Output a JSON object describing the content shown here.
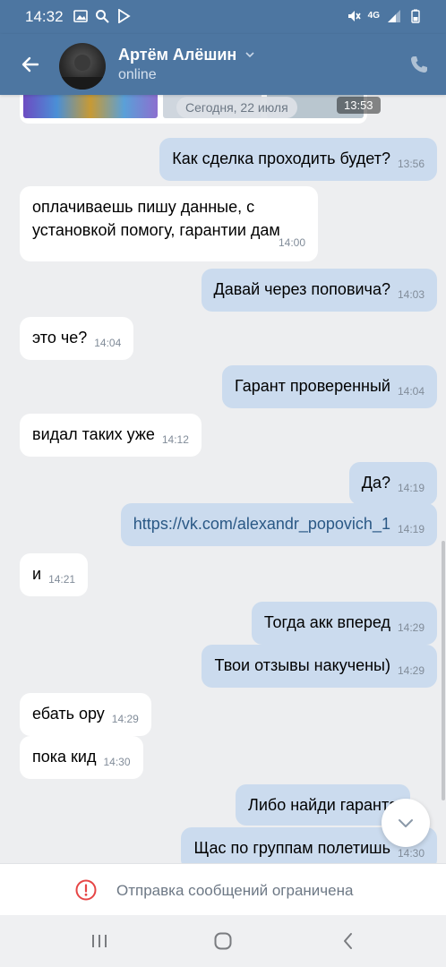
{
  "status_bar": {
    "time": "14:32",
    "icons": [
      "image-icon",
      "search-icon",
      "play-store-icon",
      "mute-icon",
      "4g-icon",
      "signal-icon",
      "battery-icon"
    ],
    "network": "4G"
  },
  "header": {
    "contact_name": "Артём Алёшин",
    "status": "online"
  },
  "top_attachment": {
    "date": "Сегодня, 22 июля",
    "time": "13:53"
  },
  "messages": [
    {
      "dir": "out",
      "text": "Как сделка проходить будет?",
      "time": "13:56"
    },
    {
      "dir": "in",
      "text": "оплачиваешь пишу данные, с установкой помогу, гарантии дам",
      "time": "14:00"
    },
    {
      "dir": "out",
      "text": "Давай через поповича?",
      "time": "14:03"
    },
    {
      "dir": "in",
      "text": "это че?",
      "time": "14:04"
    },
    {
      "dir": "out",
      "text": "Гарант проверенный",
      "time": "14:04"
    },
    {
      "dir": "in",
      "text": "видал таких уже",
      "time": "14:12"
    },
    {
      "dir": "out",
      "text": "Да?",
      "time": "14:19"
    },
    {
      "dir": "out",
      "text": "https://vk.com/alexandr_popovich_1",
      "time": "14:19",
      "link": true
    },
    {
      "dir": "in",
      "text": "и",
      "time": "14:21"
    },
    {
      "dir": "out",
      "text": "Тогда акк вперед",
      "time": "14:29"
    },
    {
      "dir": "out",
      "text": "Твои отзывы накучены)",
      "time": "14:29"
    },
    {
      "dir": "in",
      "text": "ебать ору",
      "time": "14:29"
    },
    {
      "dir": "in",
      "text": "пока кид",
      "time": "14:30"
    },
    {
      "dir": "out",
      "text": "Либо найди гаранта",
      "time": ""
    },
    {
      "dir": "out",
      "text": "Щас по группам полетишь",
      "time": "14:30"
    }
  ],
  "restriction_notice": "Отправка сообщений ограничена",
  "colors": {
    "header": "#4d76a1",
    "background": "#edeef0",
    "outgoing_bubble": "#cbdbee",
    "incoming_bubble": "#ffffff",
    "link": "#2a5885",
    "time_text": "#818c99",
    "warning": "#e64646"
  }
}
